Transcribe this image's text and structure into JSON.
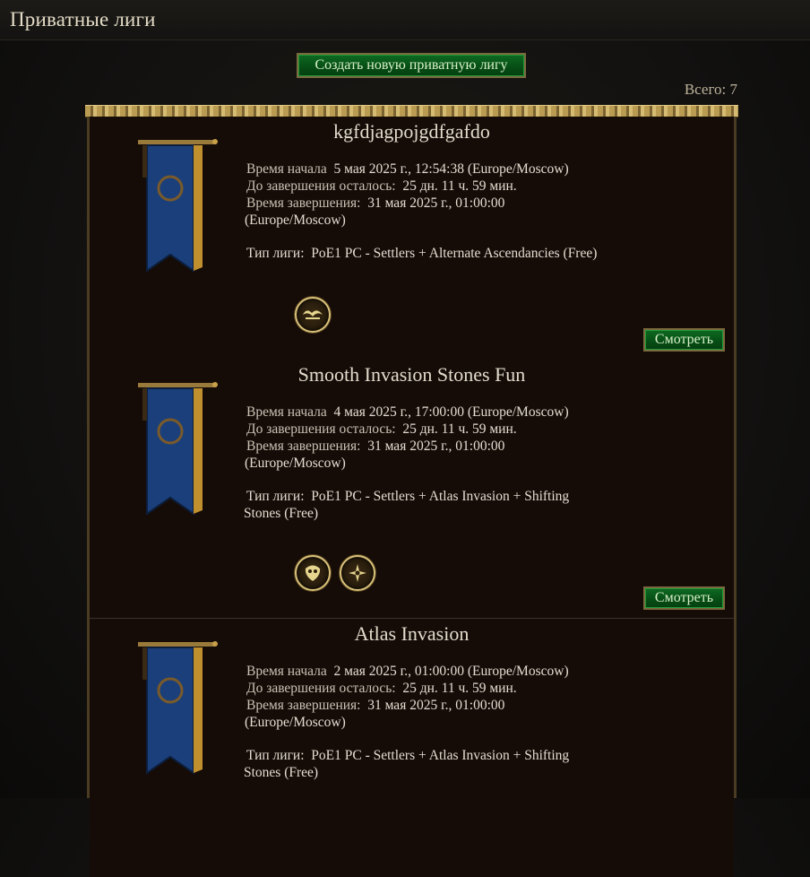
{
  "header": {
    "title": "Приватные лиги"
  },
  "actions": {
    "create_label": "Создать новую приватную лигу"
  },
  "summary": {
    "total_label": "Всего: 7"
  },
  "labels": {
    "start": "Время начала",
    "remaining": "До завершения осталось:",
    "end": "Время завершения:",
    "type": "Тип лиги:",
    "view": "Смотреть"
  },
  "leagues": [
    {
      "name": "kgfdjagpojgdfgafdo",
      "start": "5 мая 2025 г., 12:54:38 (Europe/Moscow)",
      "remaining": "25 дн. 11 ч. 59 мин.",
      "end": "31 мая 2025 г., 01:00:00",
      "tz": "(Europe/Moscow)",
      "type_a": "PoE1 PC - Settlers + Alternate Ascendancies (Free)",
      "type_b": "",
      "mods": [
        "crab-claw-icon"
      ]
    },
    {
      "name": "Smooth Invasion Stones Fun",
      "start": "4 мая 2025 г., 17:00:00 (Europe/Moscow)",
      "remaining": "25 дн. 11 ч. 59 мин.",
      "end": "31 мая 2025 г., 01:00:00",
      "tz": "(Europe/Moscow)",
      "type_a": "PoE1 PC - Settlers + Atlas Invasion + Shifting",
      "type_b": "Stones (Free)",
      "mods": [
        "mask-icon",
        "star-burst-icon"
      ]
    },
    {
      "name": "Atlas Invasion",
      "start": "2 мая 2025 г., 01:00:00 (Europe/Moscow)",
      "remaining": "25 дн. 11 ч. 59 мин.",
      "end": "31 мая 2025 г., 01:00:00",
      "tz": "(Europe/Moscow)",
      "type_a": "PoE1 PC - Settlers + Atlas Invasion + Shifting",
      "type_b": "Stones (Free)",
      "mods": []
    }
  ],
  "colors": {
    "button_green": "#0e6a22",
    "gold": "#b99b52",
    "panel": "#150c08"
  }
}
